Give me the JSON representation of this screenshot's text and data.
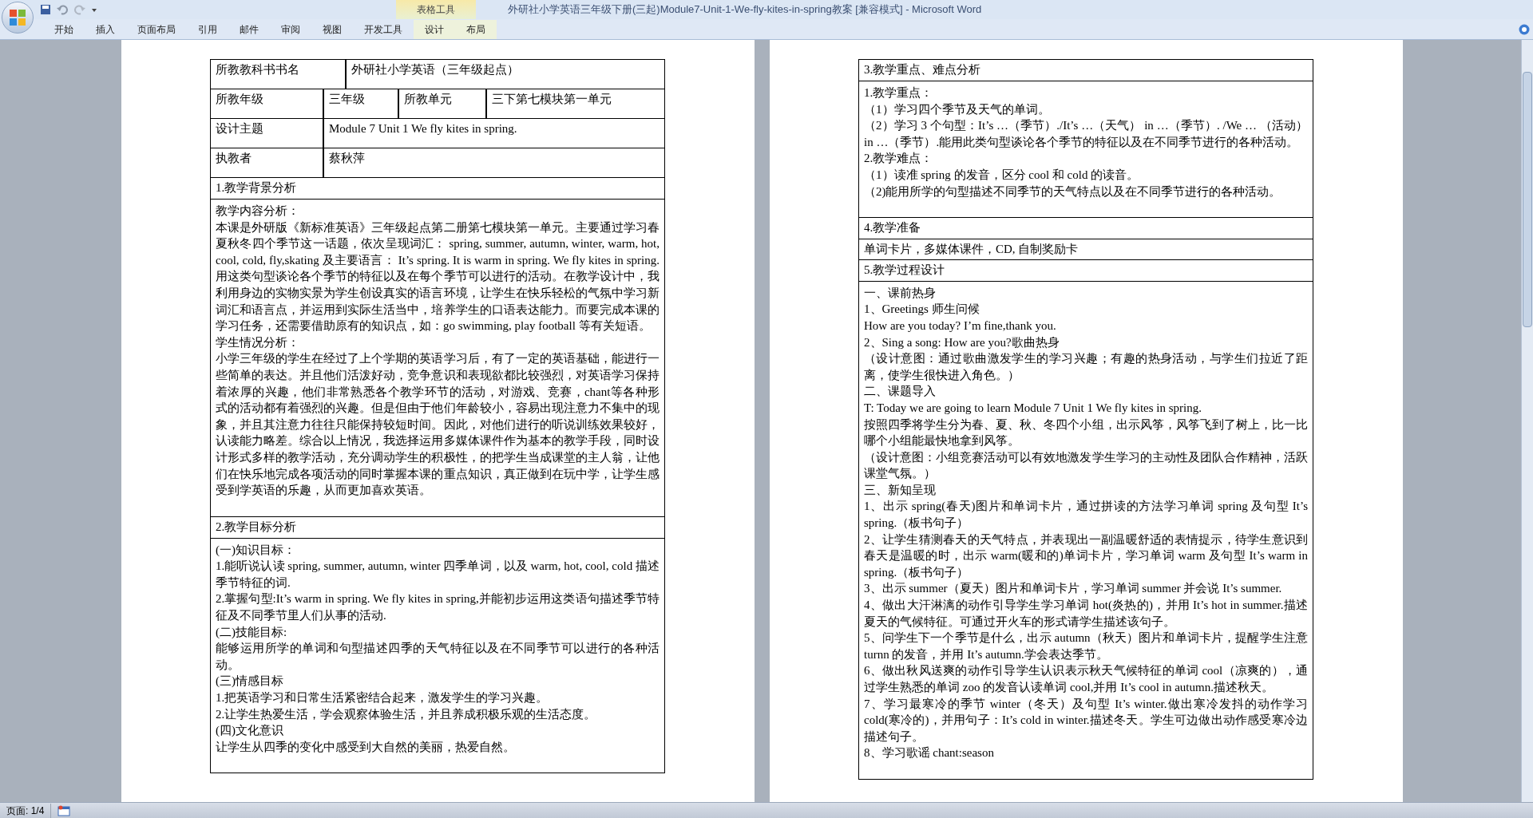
{
  "window": {
    "title": "外研社小学英语三年级下册(三起)Module7-Unit-1-We-fly-kites-in-spring教案 [兼容模式] - Microsoft Word",
    "context_group": "表格工具"
  },
  "ribbon_tabs": [
    {
      "label": "开始",
      "kind": "normal"
    },
    {
      "label": "插入",
      "kind": "normal"
    },
    {
      "label": "页面布局",
      "kind": "normal"
    },
    {
      "label": "引用",
      "kind": "normal"
    },
    {
      "label": "邮件",
      "kind": "normal"
    },
    {
      "label": "审阅",
      "kind": "normal"
    },
    {
      "label": "视图",
      "kind": "normal"
    },
    {
      "label": "开发工具",
      "kind": "normal"
    },
    {
      "label": "设计",
      "kind": "contextual"
    },
    {
      "label": "布局",
      "kind": "contextual"
    }
  ],
  "left_page": {
    "rows": [
      {
        "kind": "pair_wide",
        "cells": [
          "所教教科书书名",
          "外研社小学英语（三年级起点）"
        ]
      },
      {
        "kind": "quad",
        "cells": [
          "所教年级",
          "三年级",
          "所教单元",
          "三下第七模块第一单元"
        ]
      },
      {
        "kind": "pair",
        "cells": [
          "设计主题",
          "Module 7 Unit 1 We fly kites in spring."
        ]
      },
      {
        "kind": "pair",
        "cells": [
          "执教者",
          "蔡秋萍"
        ]
      },
      {
        "kind": "heading",
        "cells": [
          "1.教学背景分析"
        ]
      },
      {
        "kind": "body",
        "cells": [
          "教学内容分析：",
          "本课是外研版《新标准英语》三年级起点第二册第七模块第一单元。主要通过学习春夏秋冬四个季节这一话题，依次呈现词汇： spring, summer, autumn, winter, warm, hot, cool, cold, fly,skating 及主要语言： It’s spring. It is warm in spring. We fly kites in spring. 用这类句型谈论各个季节的特征以及在每个季节可以进行的活动。在教学设计中，我利用身边的实物实景为学生创设真实的语言环境，让学生在快乐轻松的气氛中学习新词汇和语言点，并运用到实际生活当中，培养学生的口语表达能力。而要完成本课的学习任务，还需要借助原有的知识点，如：go swimming, play football 等有关短语。",
          "学生情况分析：",
          "小学三年级的学生在经过了上个学期的英语学习后，有了一定的英语基础，能进行一些简单的表达。并且他们活泼好动，竞争意识和表现欲都比较强烈，对英语学习保持着浓厚的兴趣，他们非常熟悉各个教学环节的活动，对游戏、竞赛，chant等各种形式的活动都有着强烈的兴趣。但是但由于他们年龄较小，容易出现注意力不集中的现象，并且其注意力往往只能保持较短时间。因此，对他们进行的听说训练效果较好，认读能力略差。综合以上情况，我选择运用多媒体课件作为基本的教学手段，同时设计形式多样的教学活动，充分调动学生的积极性，的把学生当成课堂的主人翁，让他们在快乐地完成各项活动的同时掌握本课的重点知识，真正做到在玩中学，让学生感受到学英语的乐趣，从而更加喜欢英语。"
        ]
      },
      {
        "kind": "heading",
        "cells": [
          "2.教学目标分析"
        ]
      },
      {
        "kind": "body",
        "cells": [
          "(一)知识目标：",
          "1.能听说认读 spring, summer, autumn, winter 四季单词，以及 warm, hot, cool, cold 描述季节特征的词.",
          "2.掌握句型:It’s warm in spring. We fly kites in spring,并能初步运用这类语句描述季节特征及不同季节里人们从事的活动.",
          "(二)技能目标:",
          "能够运用所学的单词和句型描述四季的天气特征以及在不同季节可以进行的各种活动。",
          "(三)情感目标",
          "1.把英语学习和日常生活紧密结合起来，激发学生的学习兴趣。",
          "2.让学生热爱生活，学会观察体验生活，并且养成积极乐观的生活态度。",
          "(四)文化意识",
          "让学生从四季的变化中感受到大自然的美丽，热爱自然。"
        ]
      }
    ]
  },
  "right_page": {
    "rows": [
      {
        "kind": "heading",
        "cells": [
          "3.教学重点、难点分析"
        ]
      },
      {
        "kind": "body",
        "cells": [
          "1.教学重点：",
          "（1）学习四个季节及天气的单词。",
          "（2）学习 3 个句型：It’s …（季节）./It’s …（天气） in …（季节）. /We … （活动）in …（季节）.能用此类句型谈论各个季节的特征以及在不同季节进行的各种活动。",
          "2.教学难点：",
          "（1）读准 spring 的发音，区分 cool 和 cold 的读音。",
          "（2)能用所学的句型描述不同季节的天气特点以及在不同季节进行的各种活动。"
        ]
      },
      {
        "kind": "heading",
        "cells": [
          "4.教学准备"
        ]
      },
      {
        "kind": "line",
        "cells": [
          "单词卡片，多媒体课件，CD, 自制奖励卡"
        ]
      },
      {
        "kind": "heading",
        "cells": [
          "5.教学过程设计"
        ]
      },
      {
        "kind": "body",
        "cells": [
          "一、课前热身",
          "1、Greetings 师生问候",
          "How are you today? I’m fine,thank you.",
          "2、Sing a song: How are you?歌曲热身",
          "（设计意图：通过歌曲激发学生的学习兴趣；有趣的热身活动，与学生们拉近了距离，使学生很快进入角色。）",
          "二、课题导入",
          "T: Today we are going to learn Module 7 Unit 1 We fly kites in spring.",
          "按照四季将学生分为春、夏、秋、冬四个小组，出示风筝，风筝飞到了树上，比一比哪个小组能最快地拿到风筝。",
          "（设计意图：小组竞赛活动可以有效地激发学生学习的主动性及团队合作精神，活跃课堂气氛。）",
          "三、新知呈现",
          "1、出示 spring(春天)图片和单词卡片，通过拼读的方法学习单词 spring 及句型 It’s spring.（板书句子）",
          "2、让学生猜测春天的天气特点，并表现出一副温暖舒适的表情提示，待学生意识到春天是温暖的时，出示 warm(暖和的)单词卡片，学习单词 warm 及句型 It’s warm in spring.（板书句子）",
          "3、出示 summer（夏天）图片和单词卡片，学习单词 summer 并会说 It’s summer.",
          "4、做出大汗淋漓的动作引导学生学习单词 hot(炎热的)，并用 It’s hot in summer.描述夏天的气候特征。可通过开火车的形式请学生描述该句子。",
          "5、问学生下一个季节是什么，出示 autumn（秋天）图片和单词卡片，提醒学生注意 turnn 的发音，并用 It’s autumn.学会表达季节。",
          "6、做出秋风送爽的动作引导学生认识表示秋天气候特征的单词 cool（凉爽的），通过学生熟悉的单词 zoo 的发音认读单词 cool,并用 It’s cool in autumn.描述秋天。",
          "7、学习最寒冷的季节 winter（冬天）及句型 It’s winter.做出寒冷发抖的动作学习 cold(寒冷的)，并用句子：It’s cold in winter.描述冬天。学生可边做出动作感受寒冷边描述句子。",
          "8、学习歌谣 chant:season"
        ]
      }
    ]
  },
  "status_bar": {
    "page": "页面: 1/4"
  }
}
